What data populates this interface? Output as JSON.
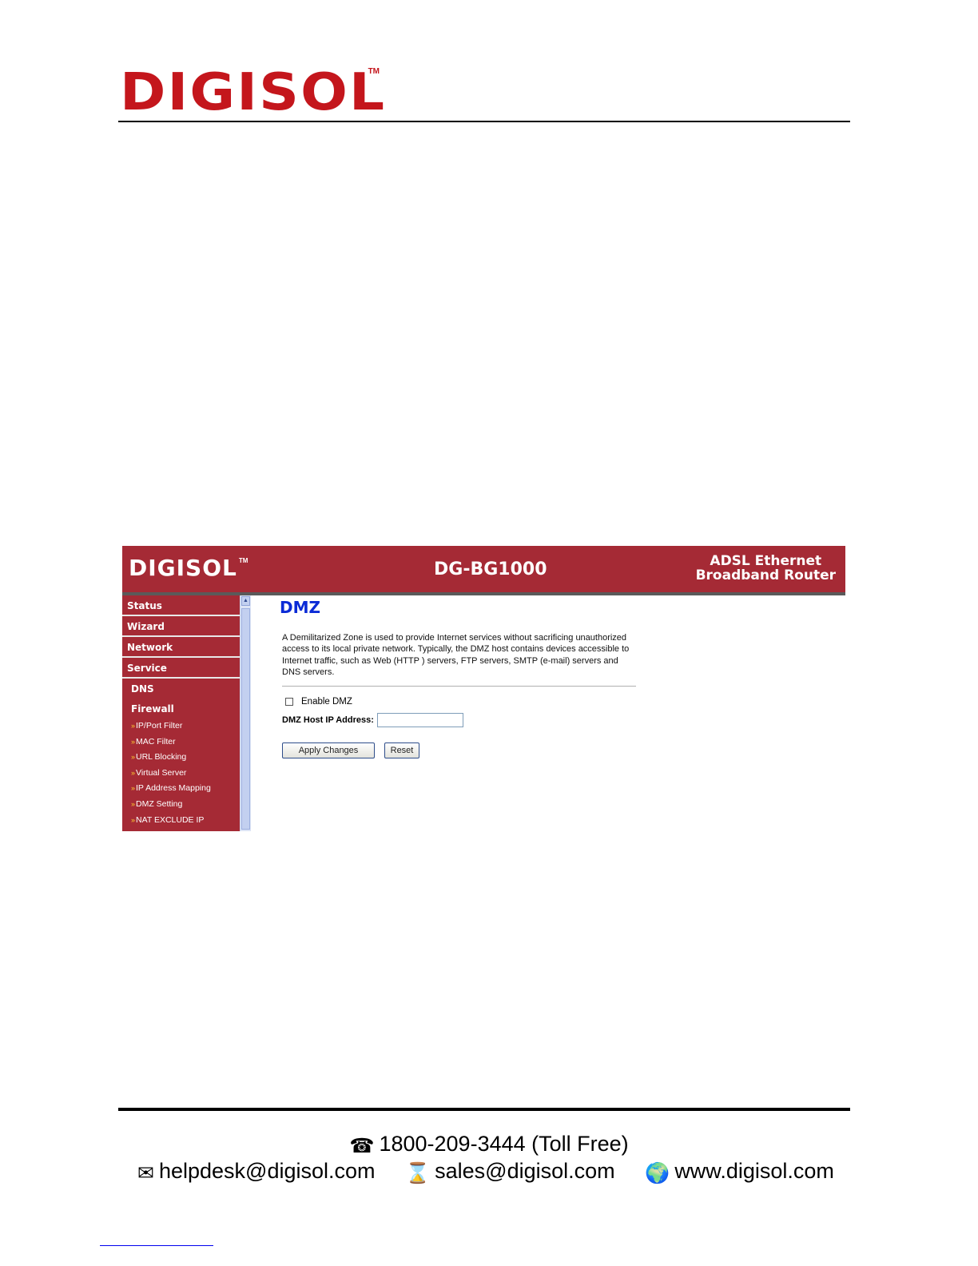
{
  "doc_header": {
    "logo_text": "DIGISOL",
    "logo_tm": "TM"
  },
  "router": {
    "banner": {
      "logo_text": "DIGISOL",
      "logo_tm": "TM",
      "model": "DG-BG1000",
      "desc_line1": "ADSL Ethernet",
      "desc_line2": "Broadband Router"
    },
    "menu": {
      "status": "Status",
      "wizard": "Wizard",
      "network": "Network",
      "service": "Service",
      "dns": "DNS",
      "firewall": "Firewall",
      "leaf_prefix": "»",
      "items": [
        "IP/Port Filter",
        "MAC Filter",
        "URL Blocking",
        "Virtual Server",
        "IP Address Mapping",
        "DMZ Setting",
        "NAT EXCLUDE IP"
      ]
    },
    "content": {
      "title": "DMZ",
      "description": "A Demilitarized Zone is used to provide Internet services without sacrificing unauthorized access to its local private network. Typically, the DMZ host contains devices accessible to Internet traffic, such as Web (HTTP ) servers, FTP servers, SMTP (e-mail) servers and DNS servers.",
      "enable_label": "Enable DMZ",
      "enable_checked": false,
      "host_label": "DMZ Host IP Address:",
      "host_value": "",
      "apply_label": "Apply Changes",
      "reset_label": "Reset"
    }
  },
  "footer": {
    "phone_icon": "☎",
    "phone": "1800-209-3444 (Toll Free)",
    "helpdesk_icon": "✉",
    "helpdesk": "helpdesk@digisol.com",
    "sales_icon": "⌛",
    "sales": "sales@digisol.com",
    "web_icon": "🌍",
    "website": "www.digisol.com"
  }
}
